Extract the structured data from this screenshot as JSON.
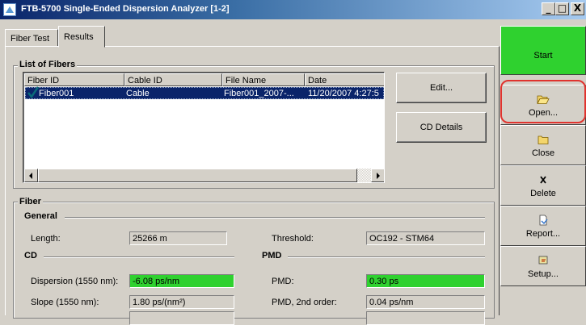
{
  "window": {
    "title": "FTB-5700 Single-Ended Dispersion Analyzer [1-2]",
    "buttons": {
      "minimize": "_",
      "maximize": "□",
      "close": "X"
    }
  },
  "tabs": [
    {
      "label": "Fiber Test",
      "active": false
    },
    {
      "label": "Results",
      "active": true
    }
  ],
  "list_of_fibers": {
    "group_label": "List of Fibers",
    "columns": [
      "Fiber ID",
      "Cable ID",
      "File Name",
      "Date"
    ],
    "rows": [
      {
        "fiber_id": "Fiber001",
        "cable_id": "Cable",
        "file_name": "Fiber001_2007-...",
        "date": "11/20/2007 4:27:5",
        "selected": true,
        "checked": true
      }
    ],
    "buttons": {
      "edit": "Edit...",
      "cd_details": "CD Details"
    }
  },
  "fiber": {
    "group_label": "Fiber",
    "general": {
      "label": "General",
      "length_label": "Length:",
      "length_value": "25266 m",
      "threshold_label": "Threshold:",
      "threshold_value": "OC192 - STM64"
    },
    "cd": {
      "label": "CD",
      "dispersion_label": "Dispersion (1550 nm):",
      "dispersion_value": "-6.08 ps/nm",
      "slope_label": "Slope (1550 nm):",
      "slope_value": "1.80 ps/(nm²)"
    },
    "pmd": {
      "label": "PMD",
      "pmd_label": "PMD:",
      "pmd_value": "0.30 ps",
      "pmd2_label": "PMD, 2nd order:",
      "pmd2_value": "0.04 ps/nm"
    }
  },
  "sidebar": {
    "start": "Start",
    "open": "Open...",
    "close": "Close",
    "delete": "Delete",
    "report": "Report...",
    "setup": "Setup..."
  },
  "colors": {
    "accent_green": "#2fd12f",
    "selection_blue": "#0a246a",
    "focus_ring": "#e0332e",
    "checkmark": "#0a6a7a"
  }
}
